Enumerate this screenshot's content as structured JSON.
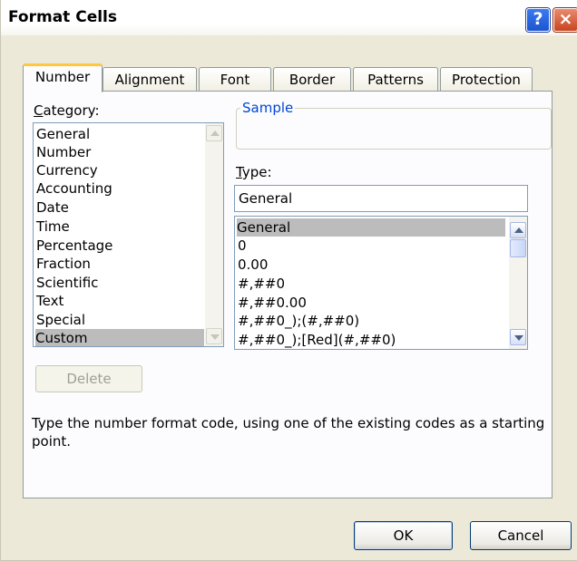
{
  "window": {
    "title": "Format Cells"
  },
  "titlebar": {
    "help_glyph": "?",
    "close_glyph": "×"
  },
  "tabs": [
    {
      "label": "Number",
      "active": true
    },
    {
      "label": "Alignment",
      "active": false
    },
    {
      "label": "Font",
      "active": false
    },
    {
      "label": "Border",
      "active": false
    },
    {
      "label": "Patterns",
      "active": false
    },
    {
      "label": "Protection",
      "active": false
    }
  ],
  "category": {
    "label": "Category:",
    "mnemonic": "C",
    "label_rest": "ategory:",
    "items": [
      "General",
      "Number",
      "Currency",
      "Accounting",
      "Date",
      "Time",
      "Percentage",
      "Fraction",
      "Scientific",
      "Text",
      "Special",
      "Custom"
    ],
    "selected": "Custom"
  },
  "sample": {
    "legend": "Sample",
    "value": ""
  },
  "type": {
    "label": "Type:",
    "mnemonic": "T",
    "label_rest": "ype:",
    "input_value": "General",
    "items": [
      "General",
      "0",
      "0.00",
      "#,##0",
      "#,##0.00",
      "#,##0_);(#,##0)",
      "#,##0_);[Red](#,##0)"
    ],
    "selected": "General"
  },
  "buttons": {
    "delete": "Delete",
    "ok": "OK",
    "cancel": "Cancel"
  },
  "description": "Type the number format code, using one of the existing codes as a starting point.",
  "colors": {
    "accent": "#0046d5",
    "tab_highlight": "#ffc83c",
    "selection": "#bcbcbc"
  }
}
